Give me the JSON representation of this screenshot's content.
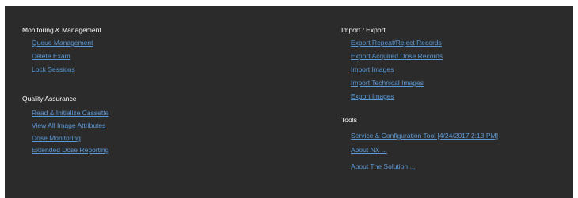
{
  "left": {
    "monitoring": {
      "title": "Monitoring & Management",
      "links": [
        "Queue Management",
        "Delete Exam",
        "Lock Sessions"
      ]
    },
    "quality": {
      "title": "Quality Assurance",
      "links": [
        "Read & Initialize Cassette",
        "View All Image Attributes",
        "Dose Monitoring",
        "Extended Dose Reporting"
      ]
    }
  },
  "right": {
    "import_export": {
      "title": "Import / Export",
      "links": [
        "Export Repeat/Reject Records",
        "Export Acquired Dose Records",
        "Import Images",
        "Import Technical Images",
        "Export Images"
      ]
    },
    "tools": {
      "title": "Tools",
      "links": [
        "Service & Configuration Tool  [4/24/2017 2:13 PM]",
        "About NX ...",
        "About The Solution ..."
      ]
    }
  },
  "colors": {
    "panel_bg": "#2b2b2b",
    "heading": "#ffffff",
    "link": "#5b9ad9"
  }
}
